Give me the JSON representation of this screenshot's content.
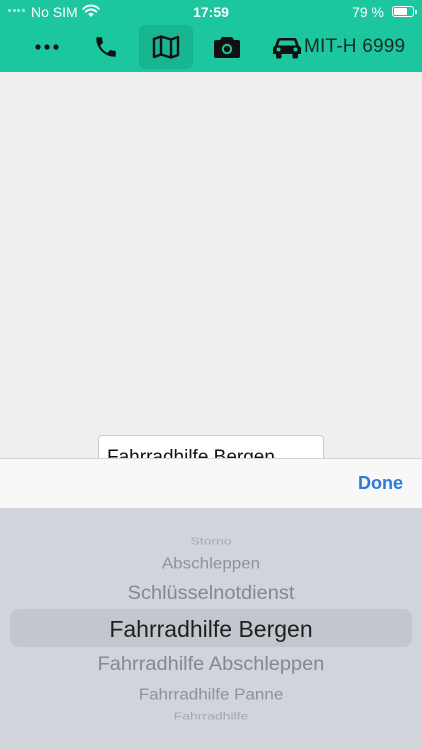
{
  "status_bar": {
    "carrier": "No SIM",
    "time": "17:59",
    "battery_percent": "79 %",
    "battery_level": 0.79
  },
  "toolbar": {
    "buttons": [
      {
        "icon": "more-icon"
      },
      {
        "icon": "phone-icon"
      },
      {
        "icon": "map-icon",
        "active": true
      },
      {
        "icon": "camera-icon"
      }
    ],
    "vehicle": {
      "icon": "car-icon",
      "plate": "MIT-H 6999"
    }
  },
  "form": {
    "field_value": "Fahrradhilfe Bergen"
  },
  "picker": {
    "done_label": "Done",
    "items": [
      "Storno",
      "Abschleppen",
      "Schlüsselnotdienst",
      "Fahrradhilfe Bergen",
      "Fahrradhilfe Abschleppen",
      "Fahrradhilfe Panne",
      "Fahrradhilfe"
    ],
    "selected_index": 3
  },
  "colors": {
    "header": "#1cc7a0",
    "header_active": "#17b592",
    "icon": "#111111",
    "done": "#2c7bd6",
    "picker_bg": "#d1d5db"
  }
}
